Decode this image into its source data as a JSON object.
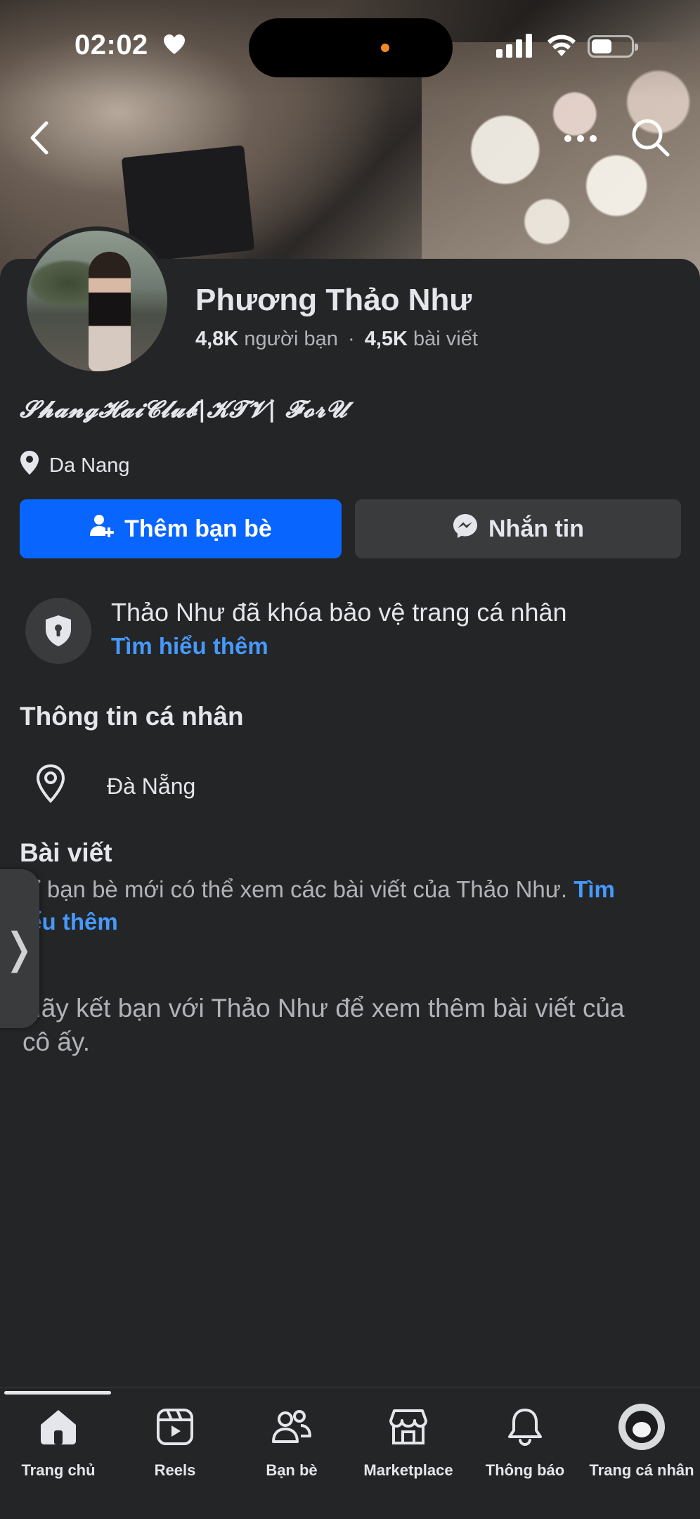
{
  "status_bar": {
    "time": "02:02"
  },
  "profile": {
    "name": "Phương Thảo Như",
    "friends_count": "4,8K",
    "friends_label": "người bạn",
    "separator": "·",
    "posts_count": "4,5K",
    "posts_label": "bài viết",
    "bio": "𝓢𝓱𝓪𝓷𝓰𝓗𝓪𝓲𝓒𝓵𝓾𝓫|𝓚𝓣𝓥| 𝓕𝓸𝓻𝓤",
    "location": "Da Nang"
  },
  "actions": {
    "add_friend": "Thêm bạn bè",
    "message": "Nhắn tin"
  },
  "lock_notice": {
    "text": "Thảo Như đã khóa bảo vệ trang cá nhân",
    "link": "Tìm hiểu thêm"
  },
  "intro": {
    "title": "Thông tin cá nhân",
    "city": "Đà Nẵng"
  },
  "posts": {
    "title": "Bài viết",
    "note": "hỉ bạn bè mới có thể xem các bài viết của Thảo Như.",
    "note_link_line1": "Tìm",
    "note_line2": "iểu thêm",
    "cta": "Hãy kết bạn với Thảo Như để xem thêm bài viết của cô ấy.",
    "cta_line1": "Hãy kết bạn với Thảo Như để xem thêm bài viết của",
    "cta_line2": "cô ấy."
  },
  "side_tab": {
    "glyph": "❭"
  },
  "tabbar": {
    "active_index": 0,
    "items": [
      {
        "label": "Trang chủ",
        "icon": "home-icon"
      },
      {
        "label": "Reels",
        "icon": "reels-icon"
      },
      {
        "label": "Bạn bè",
        "icon": "friends-icon"
      },
      {
        "label": "Marketplace",
        "icon": "marketplace-icon"
      },
      {
        "label": "Thông báo",
        "icon": "bell-icon"
      },
      {
        "label": "Trang cá nhân",
        "icon": "profile-avatar"
      }
    ]
  },
  "colors": {
    "accent": "#0866ff",
    "link": "#4599ff",
    "background": "#242526",
    "secondary_button": "#3a3b3c"
  }
}
